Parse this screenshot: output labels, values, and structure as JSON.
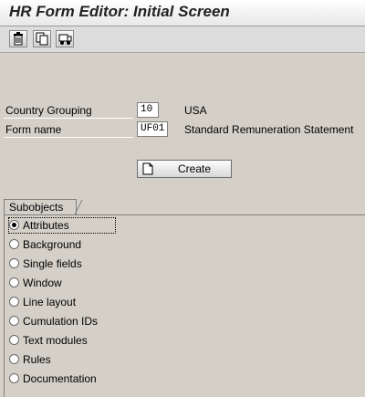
{
  "title": "HR Form Editor: Initial Screen",
  "toolbar": {
    "buttons": [
      {
        "icon": "delete-icon"
      },
      {
        "icon": "copy-icon"
      },
      {
        "icon": "transport-icon"
      }
    ]
  },
  "fields": {
    "country_grouping": {
      "label": "Country Grouping",
      "value": "10",
      "description": "USA"
    },
    "form_name": {
      "label": "Form name",
      "value": "UF01",
      "description": "Standard Remuneration Statement"
    }
  },
  "create_button": {
    "label": "Create",
    "icon": "document-icon"
  },
  "subobjects": {
    "title": "Subobjects",
    "selected": "Attributes",
    "options": [
      "Attributes",
      "Background",
      "Single fields",
      "Window",
      "Line layout",
      "Cumulation IDs",
      "Text modules",
      "Rules",
      "Documentation"
    ]
  }
}
